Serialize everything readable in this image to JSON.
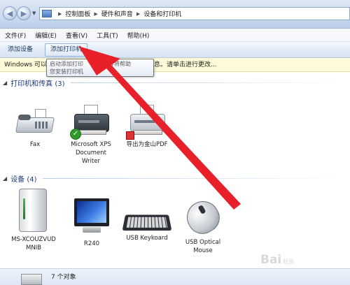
{
  "window": {
    "breadcrumb": [
      "控制面板",
      "硬件和声音",
      "设备和打印机"
    ]
  },
  "menu": [
    "文件(F)",
    "编辑(E)",
    "查看(V)",
    "工具(T)",
    "帮助(H)"
  ],
  "toolbar": {
    "add_device": "添加设备",
    "add_printer": "添加打印机"
  },
  "infobar": {
    "head": "Windows 可以",
    "tail": "信息。请单击进行更改..."
  },
  "tooltip": {
    "line1": "启动添加打印",
    "line1_tail": "。该向导将帮助",
    "line2": "您安装打印机"
  },
  "groups": {
    "printers": {
      "title": "打印机和传真 (3)"
    },
    "devices": {
      "title": "设备 (4)"
    }
  },
  "printers": [
    {
      "name": "Fax",
      "icon": "fax-icon"
    },
    {
      "name": "Microsoft XPS Document Writer",
      "icon": "printer-icon",
      "default": true
    },
    {
      "name": "导出为金山PDF",
      "icon": "printer-icon"
    }
  ],
  "devices": [
    {
      "name": "MS-XCOUZVUD MNIB",
      "icon": "computer-icon"
    },
    {
      "name": "R240",
      "icon": "monitor-icon"
    },
    {
      "name": "USB Keykoard",
      "icon": "keyboard-icon"
    },
    {
      "name": "USB Optical Mouse",
      "icon": "mouse-icon"
    }
  ],
  "status": {
    "count": "7 个对象"
  },
  "watermark": {
    "text": "Bai",
    "text2": "经验"
  },
  "colors": {
    "arrow": "#e8202a",
    "info_bg": "#fdfbd7",
    "group_title": "#1e3c7a"
  }
}
